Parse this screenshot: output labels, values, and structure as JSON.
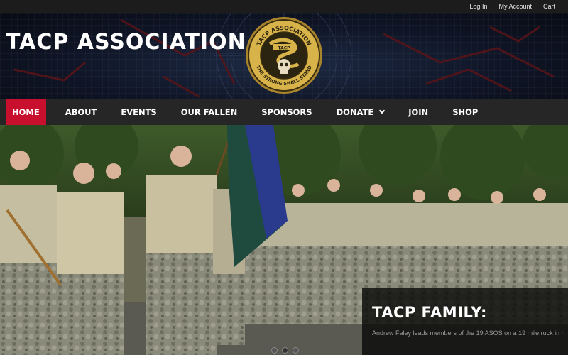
{
  "topbar": {
    "login": "Log In",
    "account": "My Account",
    "cart": "Cart"
  },
  "header": {
    "site_title": "TACP ASSOCIATION"
  },
  "logo": {
    "top_text": "TACP ASSOCIATION",
    "bottom_text": "THE STRONG SHALL STAND",
    "banner_text": "TACP"
  },
  "nav": {
    "items": [
      {
        "label": "HOME",
        "active": true
      },
      {
        "label": "ABOUT"
      },
      {
        "label": "EVENTS"
      },
      {
        "label": "OUR FALLEN"
      },
      {
        "label": "SPONSORS"
      },
      {
        "label": "DONATE",
        "dropdown": true
      },
      {
        "label": "JOIN"
      },
      {
        "label": "SHOP"
      }
    ],
    "active_color": "#c8102e"
  },
  "hero": {
    "caption_title": "TACP FAMILY:",
    "caption_text": "Andrew Faley leads members of the 19 ASOS on a 19 mile ruck in h",
    "slides": 3,
    "active_slide": 2
  }
}
